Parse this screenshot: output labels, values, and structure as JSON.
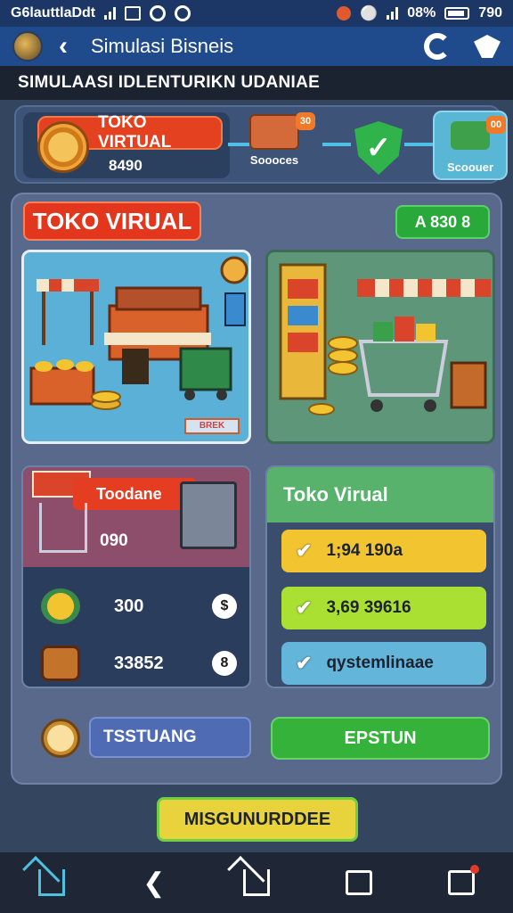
{
  "status_bar": {
    "left_text": "G6lauttlaDdt",
    "battery_text": "08%",
    "time": "790"
  },
  "app_bar": {
    "title": "Simulasi Bisneis"
  },
  "banner": {
    "text": "SIMULAASI IDLENTURIKN UDANIAE"
  },
  "progress": {
    "shop_label": "TOKO VIRTUAL",
    "shop_value": "8490",
    "node1_caption": "Soooces",
    "node1_badge": "30",
    "node3_caption": "Scoouer",
    "node3_badge": "00"
  },
  "main": {
    "title": "TOKO VIRUAL",
    "price": "A 830 8",
    "scene1_tag": "BREK",
    "left_card": {
      "label": "Toodane",
      "value": "090",
      "rows": [
        {
          "value": "300",
          "coin": "$"
        },
        {
          "value": "33852",
          "coin": "8"
        }
      ]
    },
    "right_card": {
      "title": "Toko Virual",
      "options": [
        {
          "text": "1;94 190a",
          "color": "#f2c530"
        },
        {
          "text": "3,69 39616",
          "color": "#a9e032"
        },
        {
          "text": "qystemlinaae",
          "color": "#63b6da"
        }
      ]
    },
    "btn_left": "TSSTUANG",
    "btn_right": "EPSTUN"
  },
  "bottom_button": "MISGUNURDDEE",
  "colors": {
    "accent_red": "#e2371d",
    "accent_green": "#35b23a",
    "app_bar": "#1f4a8c"
  },
  "icons": {
    "nav": [
      "home-icon",
      "back-icon",
      "home-outline-icon",
      "recents-icon",
      "notification-icon"
    ]
  }
}
